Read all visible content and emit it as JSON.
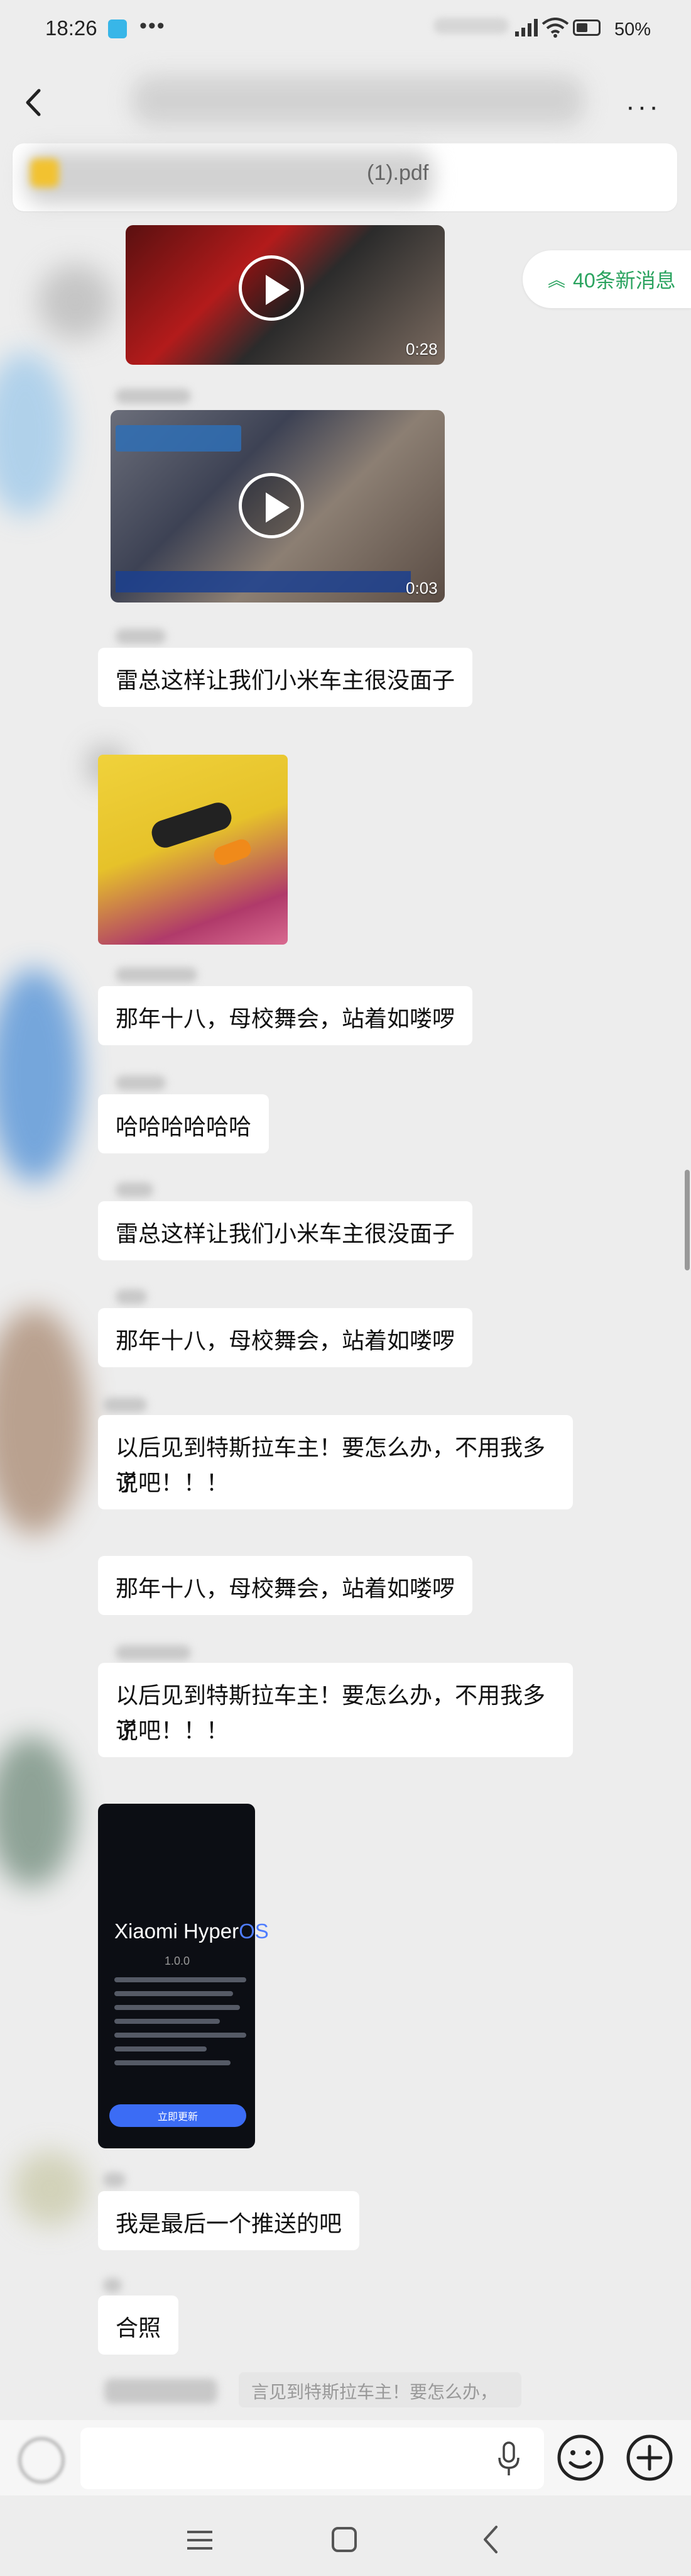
{
  "status_bar": {
    "time": "18:26",
    "more": "•••",
    "battery": "50%"
  },
  "pinned": {
    "file_name": "(1).pdf"
  },
  "new_messages": {
    "label": "40条新消息"
  },
  "videos": [
    {
      "duration": "0:28"
    },
    {
      "duration": "0:03"
    }
  ],
  "messages": [
    {
      "lines": [
        "雷总这样让我们小米车主很没面子"
      ]
    },
    {
      "lines": [
        "那年十八，母校舞会，站着如喽啰"
      ]
    },
    {
      "lines": [
        "哈哈哈哈哈哈"
      ]
    },
    {
      "lines": [
        "雷总这样让我们小米车主很没面子"
      ]
    },
    {
      "lines": [
        "那年十八，母校舞会，站着如喽啰"
      ]
    },
    {
      "lines": [
        "以后见到特斯拉车主！要怎么办，不用我多说",
        "了吧！！！"
      ]
    },
    {
      "lines": [
        "那年十八，母校舞会，站着如喽啰"
      ]
    },
    {
      "lines": [
        "以后见到特斯拉车主！要怎么办，不用我多说",
        "了吧！！！"
      ]
    },
    {
      "lines": [
        "我是最后一个推送的吧"
      ]
    },
    {
      "lines": [
        "合照"
      ]
    }
  ],
  "screenshot_image": {
    "title_part1": "Xiaomi Hyper",
    "title_part2": "OS",
    "version": "1.0.0",
    "button": "立即更新"
  },
  "quote": {
    "text": "言见到特斯拉车主！要怎么办，"
  },
  "icons": {
    "back": "chevron-left-icon",
    "more": "more-dots-icon",
    "mic": "mic-icon",
    "emoji": "emoji-icon",
    "plus": "plus-icon"
  },
  "colors": {
    "accent_green": "#2aa35f",
    "chat_background": "#ededed",
    "bubble": "#ffffff"
  }
}
